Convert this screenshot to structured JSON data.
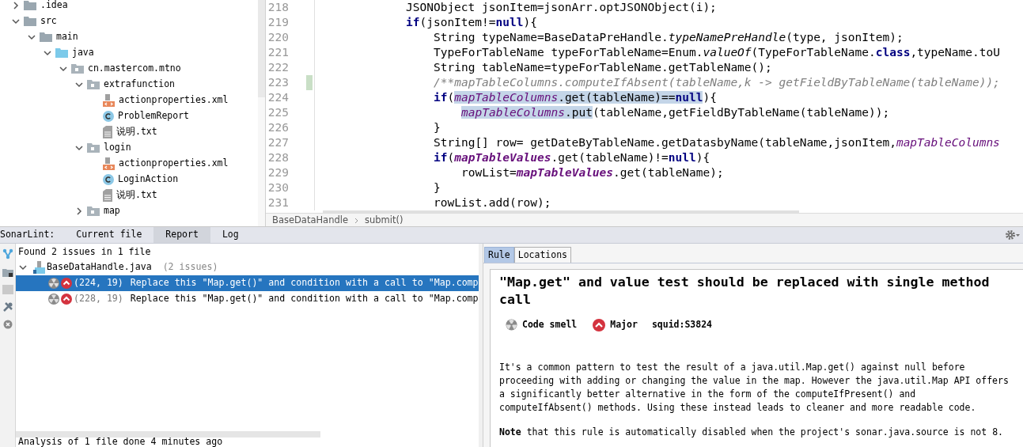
{
  "project_tree": [
    {
      "label": ".idea",
      "kind": "folder",
      "expanded": false
    },
    {
      "label": "src",
      "kind": "folder",
      "expanded": true,
      "children": [
        {
          "label": "main",
          "kind": "folder",
          "expanded": true,
          "children": [
            {
              "label": "java",
              "kind": "source_folder",
              "expanded": true,
              "children": [
                {
                  "label": "cn.mastercom.mtno",
                  "kind": "package",
                  "expanded": true,
                  "children": [
                    {
                      "label": "extrafunction",
                      "kind": "package",
                      "expanded": true,
                      "children": [
                        {
                          "label": "actionproperties.xml",
                          "kind": "xml"
                        },
                        {
                          "label": "ProblemReport",
                          "kind": "class"
                        },
                        {
                          "label": "说明.txt",
                          "kind": "text"
                        }
                      ]
                    },
                    {
                      "label": "login",
                      "kind": "package",
                      "expanded": true,
                      "children": [
                        {
                          "label": "actionproperties.xml",
                          "kind": "xml"
                        },
                        {
                          "label": "LoginAction",
                          "kind": "class"
                        },
                        {
                          "label": "说明.txt",
                          "kind": "text"
                        }
                      ]
                    },
                    {
                      "label": "map",
                      "kind": "package",
                      "expanded": false
                    }
                  ]
                }
              ]
            }
          ]
        }
      ]
    }
  ],
  "editor": {
    "lines": [
      {
        "number": "218",
        "changed": false,
        "segments": [
          {
            "text": "JSONObject jsonItem=jsonArr.optJSONObject(i);",
            "kind": "plain"
          }
        ]
      },
      {
        "number": "219",
        "changed": false,
        "segments": [
          {
            "text": "if",
            "kind": "keyword"
          },
          {
            "text": "(jsonItem!=",
            "kind": "plain"
          },
          {
            "text": "null",
            "kind": "keyword"
          },
          {
            "text": "){",
            "kind": "plain"
          }
        ],
        "children": [
          {
            "number": "220",
            "changed": false,
            "segments": [
              {
                "text": "String typeName=BaseDataPreHandle.",
                "kind": "plain"
              },
              {
                "text": "typeNamePreHandle",
                "kind": "italic"
              },
              {
                "text": "(type, jsonItem);",
                "kind": "plain"
              }
            ]
          },
          {
            "number": "221",
            "changed": false,
            "segments": [
              {
                "text": "TypeForTableName typeForTableName=Enum.",
                "kind": "plain"
              },
              {
                "text": "valueOf",
                "kind": "italic"
              },
              {
                "text": "(TypeForTableName.",
                "kind": "plain"
              },
              {
                "text": "class",
                "kind": "keyword"
              },
              {
                "text": ",typeName.toU",
                "kind": "plain"
              }
            ]
          },
          {
            "number": "222",
            "changed": false,
            "segments": [
              {
                "text": "String tableName=typeForTableName.getTableName();",
                "kind": "plain"
              }
            ]
          },
          {
            "number": "223",
            "changed": true,
            "segments": [
              {
                "text": "/**mapTableColumns.computeIfAbsent(tableName,k -> getFieldByTableName(tableName));",
                "kind": "comment"
              }
            ]
          },
          {
            "number": "224",
            "changed": false,
            "segments": [
              {
                "text": "if",
                "kind": "keyword"
              },
              {
                "text": "(",
                "kind": "plain"
              },
              {
                "text": "mapTableColumns",
                "kind": "field",
                "highlighted": true
              },
              {
                "text": ".get(tableName)==",
                "kind": "plain",
                "highlighted": true
              },
              {
                "text": "null",
                "kind": "keyword",
                "highlighted": true
              },
              {
                "text": "){",
                "kind": "plain"
              }
            ],
            "children": [
              {
                "number": "225",
                "changed": false,
                "segments": [
                  {
                    "text": "mapTableColumns",
                    "kind": "field",
                    "highlighted": true
                  },
                  {
                    "text": ".put",
                    "kind": "plain",
                    "highlighted": true
                  },
                  {
                    "text": "(tableName,getFieldByTableName(tableName));",
                    "kind": "plain"
                  }
                ]
              }
            ]
          },
          {
            "number": "226",
            "changed": false,
            "segments": [
              {
                "text": "}",
                "kind": "plain"
              }
            ]
          },
          {
            "number": "227",
            "changed": false,
            "segments": [
              {
                "text": "String[] row= getDateByTableName.getDatasbyName(tableName,jsonItem,",
                "kind": "plain"
              },
              {
                "text": "mapTableColumns",
                "kind": "field"
              }
            ]
          },
          {
            "number": "228",
            "changed": false,
            "segments": [
              {
                "text": "if",
                "kind": "keyword"
              },
              {
                "text": "(",
                "kind": "plain"
              },
              {
                "text": "mapTableValues",
                "kind": "constant"
              },
              {
                "text": ".get(tableName)!=",
                "kind": "plain"
              },
              {
                "text": "null",
                "kind": "keyword"
              },
              {
                "text": "){",
                "kind": "plain"
              }
            ],
            "children": [
              {
                "number": "229",
                "changed": false,
                "segments": [
                  {
                    "text": "rowList=",
                    "kind": "plain"
                  },
                  {
                    "text": "mapTableValues",
                    "kind": "constant"
                  },
                  {
                    "text": ".get(tableName);",
                    "kind": "plain"
                  }
                ]
              }
            ]
          },
          {
            "number": "230",
            "changed": false,
            "segments": [
              {
                "text": "}",
                "kind": "plain"
              }
            ]
          },
          {
            "number": "231",
            "changed": false,
            "segments": [
              {
                "text": "rowList.add(row);",
                "kind": "plain"
              }
            ]
          }
        ]
      }
    ],
    "breadcrumb": [
      "BaseDataHandle",
      "submit()"
    ]
  },
  "sonarlint": {
    "title": "SonarLint:",
    "tabs": [
      {
        "label": "Current file",
        "selected": false
      },
      {
        "label": "Report",
        "selected": true
      },
      {
        "label": "Log",
        "selected": false
      }
    ],
    "summary": "Found 2 issues in 1 file",
    "file": {
      "name": "BaseDataHandle.java",
      "count": "(2 issues)",
      "expanded": true
    },
    "issues": [
      {
        "position": "(224, 19)",
        "message": "Replace this \"Map.get()\" and condition with a call to \"Map.comp",
        "selected": true
      },
      {
        "position": "(228, 19)",
        "message": "Replace this \"Map.get()\" and condition with a call to \"Map.comp",
        "selected": false
      }
    ],
    "status": "Analysis of 1 file done 4 minutes ago"
  },
  "rule_panel": {
    "tabs": [
      {
        "label": "Rule",
        "selected": true
      },
      {
        "label": "Locations",
        "selected": false
      }
    ],
    "title": "\"Map.get\" and value test should be replaced with single method call",
    "type": "Code smell",
    "severity": "Major",
    "key": "squid:S3824",
    "description": "It's a common pattern to test the result of a java.util.Map.get() against null before proceeding with adding or changing the value in the map. However the java.util.Map API offers a significantly better alternative in the form of the computeIfPresent() and computeIfAbsent() methods. Using these instead leads to cleaner and more readable code.",
    "note": "**Note** that this rule is automatically disabled when the project's sonar.java.source is not 8."
  }
}
